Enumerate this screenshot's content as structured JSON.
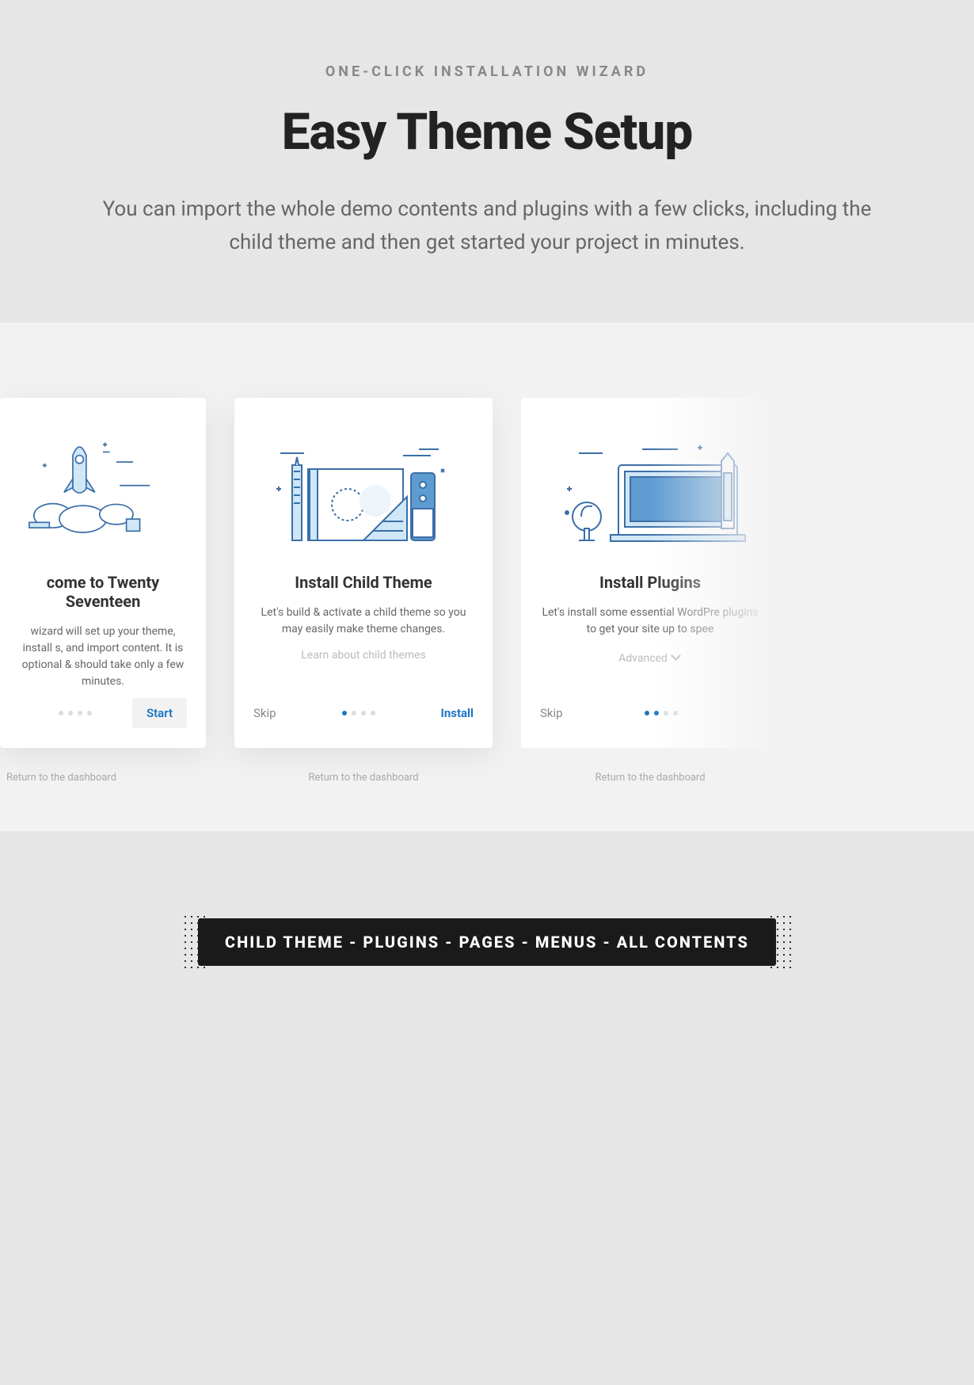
{
  "hero": {
    "eyebrow": "ONE-CLICK INSTALLATION WIZARD",
    "title": "Easy Theme Setup",
    "description": "You can import the whole demo contents and plugins with a few clicks, including the child theme and then get started your project in minutes."
  },
  "cards": [
    {
      "title": "come to Twenty Seventeen",
      "text": "wizard will set up your theme, install \ns, and import content. It is optional & should take only a few minutes.",
      "skip": "",
      "action": "Start",
      "dots_active": [],
      "return": "Return to the dashboard"
    },
    {
      "title": "Install Child Theme",
      "text": "Let's build & activate a child theme so you may easily make theme changes.",
      "link": "Learn about child themes",
      "skip": "Skip",
      "action": "Install",
      "dots_active": [
        0
      ],
      "return": "Return to the dashboard"
    },
    {
      "title": "Install Plugins",
      "text": "Let's install some essential WordPre plugins to get your site up to spee",
      "advanced": "Advanced",
      "skip": "Skip",
      "action": "",
      "dots_active": [
        0,
        1
      ],
      "return": "Return to the dashboard"
    }
  ],
  "banner": "CHILD THEME - PLUGINS - PAGES - MENUS - ALL CONTENTS"
}
